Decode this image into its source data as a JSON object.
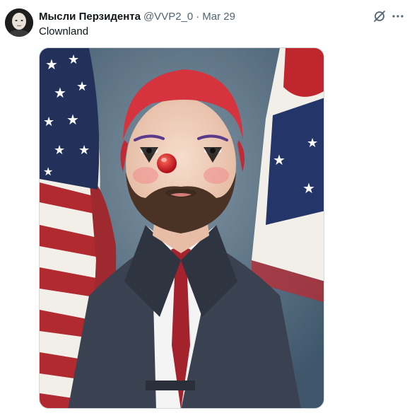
{
  "tweet": {
    "author_name": "Мысли Перзидента",
    "author_handle": "@VVP2_0",
    "separator": "·",
    "date": "Mar 29",
    "text": "Clownland"
  },
  "icons": {
    "avatar": "profile-avatar",
    "grok": "grok-slash-icon",
    "more": "more-options-icon"
  },
  "colors": {
    "text_primary": "#0f1419",
    "text_secondary": "#536471",
    "border": "#cfd9de"
  }
}
